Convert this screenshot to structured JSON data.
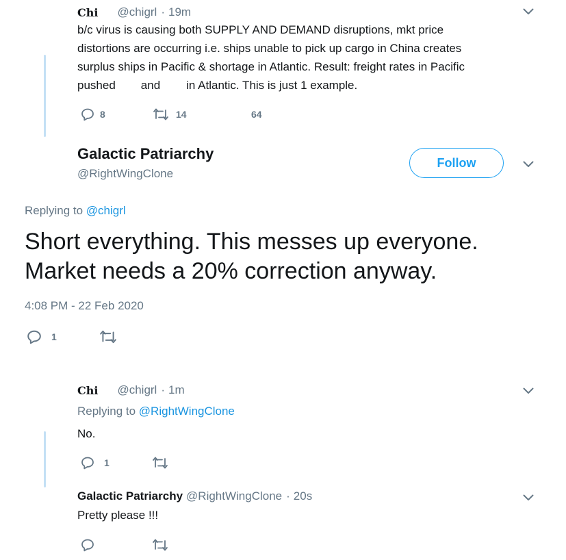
{
  "tweet1": {
    "display_name": "Chi",
    "handle": "@chigrl",
    "sep": "·",
    "time": "19m",
    "lines": [
      "b/c virus is causing both SUPPLY AND DEMAND disruptions, mkt price",
      "distortions are occurring i.e. ships unable to pick up cargo in China creates",
      "surplus ships in Pacific & shortage in Atlantic. Result: freight rates in Pacific"
    ],
    "line4_a": "pushed",
    "line4_b": "and",
    "line4_c": "in Atlantic. This is just 1 example.",
    "reply_count": "8",
    "retweet_count": "14",
    "like_count": "64"
  },
  "main_tweet": {
    "display_name": "Galactic Patriarchy",
    "handle": "@RightWingClone",
    "follow_label": "Follow",
    "replying_to_label": "Replying to",
    "replying_to_handle": "@chigrl",
    "text_line1": "Short everything. This messes up everyone.",
    "text_line2": "Market needs a 20% correction anyway.",
    "timestamp": "4:08 PM - 22 Feb 2020",
    "reply_count": "1"
  },
  "reply1": {
    "display_name": "Chi",
    "handle": "@chigrl",
    "sep": "·",
    "time": "1m",
    "replying_to_label": "Replying to",
    "replying_to_handle": "@RightWingClone",
    "text": "No.",
    "reply_count": "1"
  },
  "reply2": {
    "display_name": "Galactic Patriarchy",
    "handle": "@RightWingClone",
    "sep": "·",
    "time": "20s",
    "text": "Pretty please !!!"
  },
  "icons": {
    "reply": "reply-icon",
    "retweet": "retweet-icon",
    "like": "like-icon",
    "more": "chevron-down-icon"
  },
  "colors": {
    "link": "#1b95e0",
    "muted": "#657786",
    "follow": "#1da1f2",
    "thread_line": "#c4e0f5"
  }
}
